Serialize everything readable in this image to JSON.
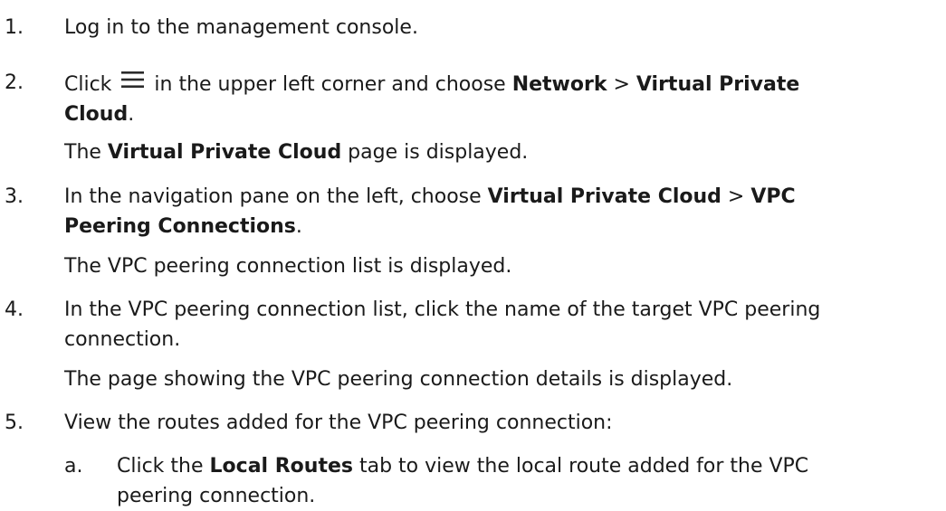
{
  "steps": [
    {
      "num": "1.",
      "parts": {
        "t1": "Log in to the management console."
      }
    },
    {
      "num": "2.",
      "parts": {
        "t1": "Click",
        "icon": "menu-icon",
        "t2": " in the upper left corner and choose ",
        "b1": "Network",
        "t3": " > ",
        "b2": "Virtual Private",
        "b3": "Cloud",
        "t4": "."
      },
      "result": {
        "t1": "The ",
        "b1": "Virtual Private Cloud",
        "t2": " page is displayed."
      }
    },
    {
      "num": "3.",
      "parts": {
        "t1": "In the navigation pane on the left, choose ",
        "b1": "Virtual Private Cloud",
        "t2": " > ",
        "b2": "VPC",
        "b3": "Peering Connections",
        "t3": "."
      },
      "result": {
        "t1": "The VPC peering connection list is displayed."
      }
    },
    {
      "num": "4.",
      "parts": {
        "t1": "In the VPC peering connection list, click the name of the target VPC peering",
        "t2": "connection."
      },
      "result": {
        "t1": "The page showing the VPC peering connection details is displayed."
      }
    },
    {
      "num": "5.",
      "parts": {
        "t1": "View the routes added for the VPC peering connection:"
      },
      "substeps": [
        {
          "num": "a.",
          "t1": "Click the ",
          "b1": "Local Routes",
          "t2": " tab to view the local route added for the VPC",
          "t3": "peering connection."
        }
      ]
    }
  ]
}
